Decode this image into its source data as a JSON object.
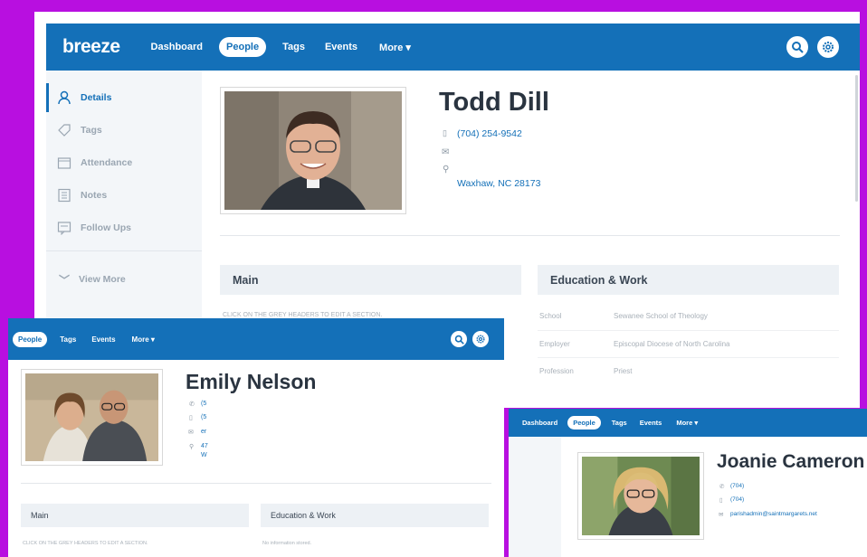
{
  "colors": {
    "background": "#b80fe0",
    "nav": "#1470b8",
    "accent": "#1470b8"
  },
  "todd": {
    "logo": "breeze",
    "nav": [
      "Dashboard",
      "People",
      "Tags",
      "Events",
      "More"
    ],
    "active_nav": "People",
    "sidebar": [
      "Details",
      "Tags",
      "Attendance",
      "Notes",
      "Follow Ups"
    ],
    "view_more": "View More",
    "name": "Todd Dill",
    "phone": "(704) 254-9542",
    "address": "Waxhaw, NC 28173",
    "main_header": "Main",
    "main_hint": "CLICK ON THE GREY HEADERS TO EDIT A SECTION.",
    "edu_header": "Education & Work",
    "edu_rows": [
      {
        "label": "School",
        "value": "Sewanee School of Theology"
      },
      {
        "label": "Employer",
        "value": "Episcopal Diocese of North Carolina"
      },
      {
        "label": "Profession",
        "value": "Priest"
      }
    ]
  },
  "emily": {
    "nav": [
      "People",
      "Tags",
      "Events",
      "More"
    ],
    "name": "Emily Nelson",
    "phone1": "(5",
    "phone2": "(5",
    "email": "er",
    "address1": "47",
    "address2": "W",
    "main_header": "Main",
    "main_hint": "CLICK ON THE GREY HEADERS TO EDIT A SECTION.",
    "edu_header": "Education & Work",
    "edu_empty": "No information stored."
  },
  "joanie": {
    "nav": [
      "Dashboard",
      "People",
      "Tags",
      "Events",
      "More"
    ],
    "name": "Joanie Cameron",
    "phone1": "(704)",
    "phone2": "(704)",
    "email": "parishadmin@saintmargarets.net"
  }
}
